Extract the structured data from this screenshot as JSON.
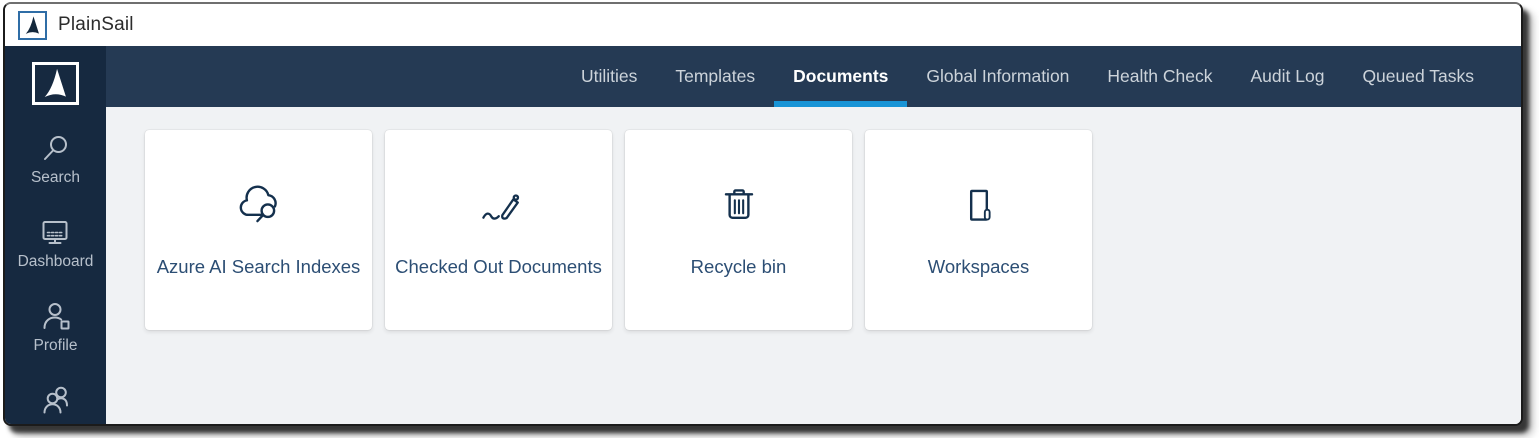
{
  "window": {
    "app_title": "PlainSail"
  },
  "navbar": {
    "tabs": [
      {
        "label": "Utilities",
        "active": false
      },
      {
        "label": "Templates",
        "active": false
      },
      {
        "label": "Documents",
        "active": true
      },
      {
        "label": "Global Information",
        "active": false
      },
      {
        "label": "Health Check",
        "active": false
      },
      {
        "label": "Audit Log",
        "active": false
      },
      {
        "label": "Queued Tasks",
        "active": false
      }
    ]
  },
  "sidebar": {
    "items": [
      {
        "label": "Search",
        "icon": "search-icon"
      },
      {
        "label": "Dashboard",
        "icon": "dashboard-icon"
      },
      {
        "label": "Profile",
        "icon": "profile-icon"
      },
      {
        "label": "",
        "icon": "users-icon"
      }
    ]
  },
  "content": {
    "cards": [
      {
        "label": "Azure AI Search Indexes",
        "icon": "cloud-search-icon"
      },
      {
        "label": "Checked Out Documents",
        "icon": "pen-signature-icon"
      },
      {
        "label": "Recycle bin",
        "icon": "trash-icon"
      },
      {
        "label": "Workspaces",
        "icon": "workspace-icon"
      }
    ]
  },
  "colors": {
    "accent_underline": "#1894d6",
    "navbar_bg": "#253a54",
    "sidebar_bg": "#162940",
    "content_bg": "#f0f2f4",
    "card_text": "#2c4e74",
    "icon_stroke": "#14304d",
    "logo_border": "#2f6da6",
    "inactive_tab_text": "#ccd3da",
    "sidebar_text": "#b7c0cb"
  }
}
